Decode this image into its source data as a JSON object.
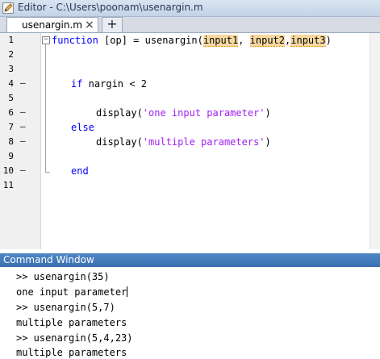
{
  "window": {
    "title": "Editor - C:\\Users\\poonam\\usenargin.m",
    "icon": "editor-pencil-icon"
  },
  "tabs": [
    {
      "label": "usenargin.m",
      "close": "×"
    }
  ],
  "new_tab_label": "+",
  "editor": {
    "lines": [
      {
        "num": "1",
        "marker": ""
      },
      {
        "num": "2",
        "marker": ""
      },
      {
        "num": "3",
        "marker": ""
      },
      {
        "num": "4",
        "marker": "–"
      },
      {
        "num": "5",
        "marker": ""
      },
      {
        "num": "6",
        "marker": "–"
      },
      {
        "num": "7",
        "marker": "–"
      },
      {
        "num": "8",
        "marker": "–"
      },
      {
        "num": "9",
        "marker": ""
      },
      {
        "num": "10",
        "marker": "–"
      },
      {
        "num": "11",
        "marker": ""
      }
    ],
    "code": {
      "l1_kw": "function",
      "l1_mid": " [op] = usenargin(",
      "l1_a1": "input1",
      "l1_sep1": ", ",
      "l1_a2": "input2",
      "l1_sep2": ",",
      "l1_a3": "input3",
      "l1_end": ")",
      "l4_kw": "if",
      "l4_rest": " nargin < 2",
      "l6_pre": "display(",
      "l6_str": "'one input parameter'",
      "l6_post": ")",
      "l7_kw": "else",
      "l8_pre": "display(",
      "l8_str": "'multiple parameters'",
      "l8_post": ")",
      "l10_kw": "end"
    },
    "fold_symbol": "−"
  },
  "command_window": {
    "title": "Command Window",
    "lines": [
      ">> usenargin(35)",
      "one input parameter",
      ">> usenargin(5,7)",
      "multiple parameters",
      ">> usenargin(5,4,23)",
      "multiple parameters"
    ]
  },
  "colors": {
    "keyword": "#0000ff",
    "string": "#a020f0",
    "warning_highlight": "#f7d9a0",
    "command_window_bar": "#3a6fb0"
  }
}
